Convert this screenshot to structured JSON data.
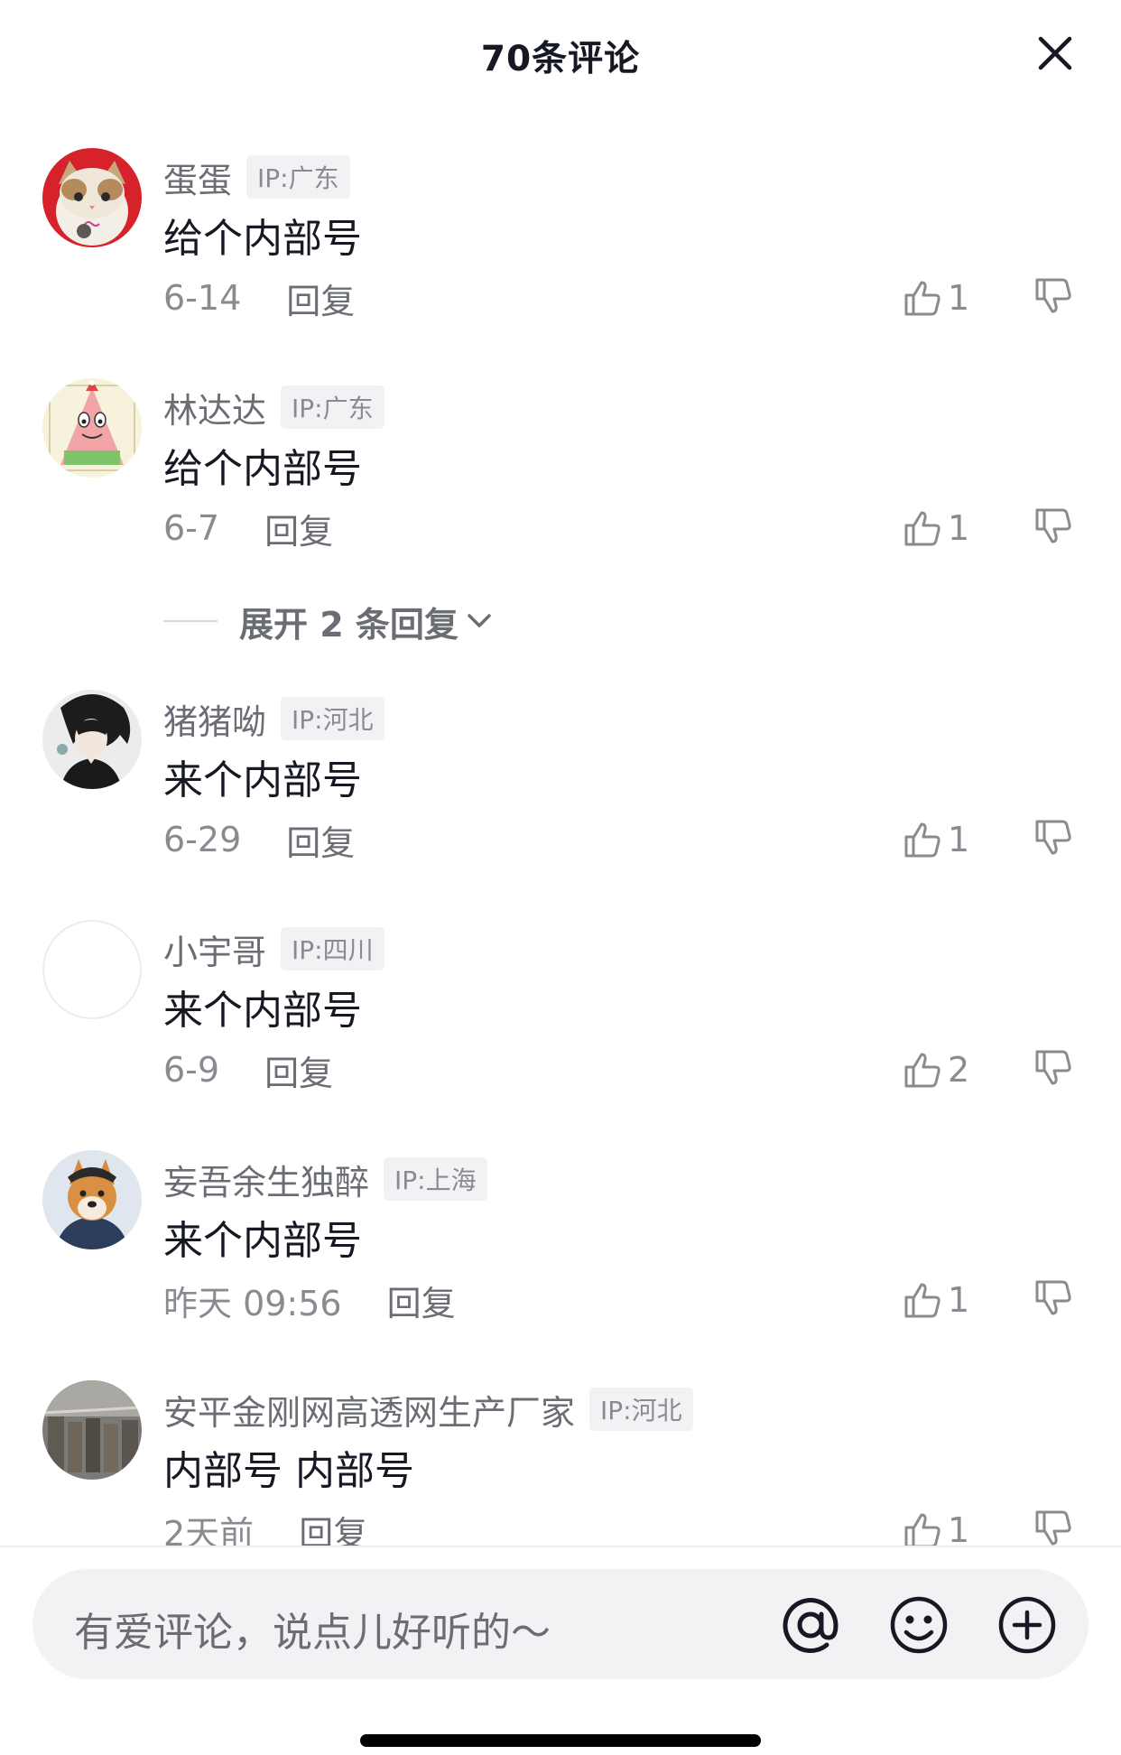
{
  "header": {
    "title": "70条评论",
    "close_icon": "close-icon"
  },
  "comments": [
    {
      "username": "蛋蛋",
      "ip": "IP:广东",
      "text": "给个内部号",
      "date": "6-14",
      "reply": "回复",
      "likes": "1",
      "avatar": "cat-avatar"
    },
    {
      "username": "林达达",
      "ip": "IP:广东",
      "text": "给个内部号",
      "date": "6-7",
      "reply": "回复",
      "likes": "1",
      "avatar": "patrick-star-avatar"
    },
    {
      "username": "猪猪呦",
      "ip": "IP:河北",
      "text": "来个内部号",
      "date": "6-29",
      "reply": "回复",
      "likes": "1",
      "avatar": "anime-boy-avatar"
    },
    {
      "username": "小宇哥",
      "ip": "IP:四川",
      "text": "来个内部号",
      "date": "6-9",
      "reply": "回复",
      "likes": "2",
      "avatar": "blank-avatar"
    },
    {
      "username": "妄吾余生独醉",
      "ip": "IP:上海",
      "text": "来个内部号",
      "date": "昨天 09:56",
      "reply": "回复",
      "likes": "1",
      "avatar": "shiba-dog-avatar"
    },
    {
      "username": "安平金刚网高透网生产厂家",
      "ip": "IP:河北",
      "text": "内部号 内部号",
      "date": "2天前",
      "reply": "回复",
      "likes": "1",
      "avatar": "factory-photo-avatar"
    }
  ],
  "expand_replies": {
    "label": "展开 2 条回复"
  },
  "input": {
    "placeholder": "有爱评论，说点儿好听的～"
  },
  "colors": {
    "text_primary": "#161823",
    "text_secondary": "#8a8b91",
    "input_bg": "#f2f2f4"
  }
}
